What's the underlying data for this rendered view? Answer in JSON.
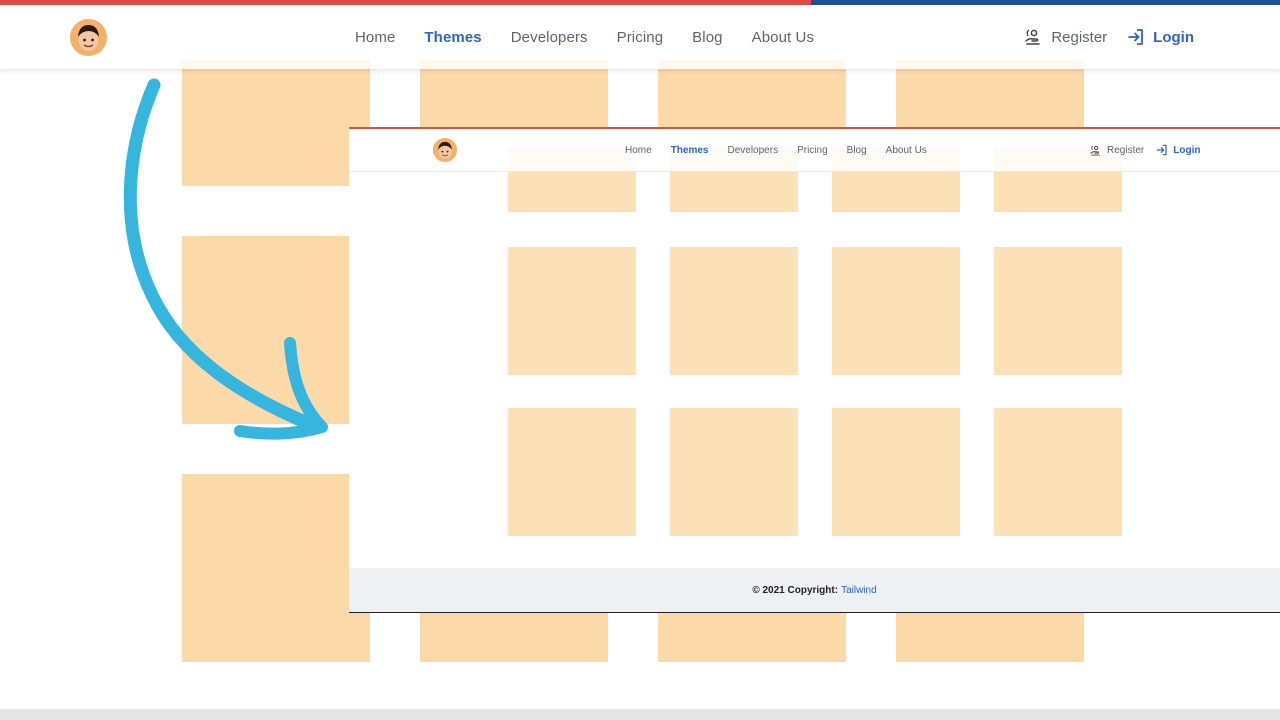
{
  "nav": {
    "items": [
      {
        "label": "Home"
      },
      {
        "label": "Themes"
      },
      {
        "label": "Developers"
      },
      {
        "label": "Pricing"
      },
      {
        "label": "Blog"
      },
      {
        "label": "About Us"
      }
    ],
    "active": "Themes",
    "register_label": "Register",
    "login_label": "Login"
  },
  "footer": {
    "copyright": "© 2021 Copyright:",
    "brand": "Tailwind"
  },
  "colors": {
    "accent": "#2f63c5",
    "progress_track": "#1e4f96",
    "progress_fill": "#e14848",
    "placeholder_block": "#fcd9a8",
    "arrow": "#36b5de",
    "footer_bg": "#eff0f3"
  },
  "icons": {
    "logo": "avatar-logo-icon",
    "register": "hand-register-icon",
    "login": "login-arrow-icon",
    "annotation": "curved-arrow-icon"
  }
}
